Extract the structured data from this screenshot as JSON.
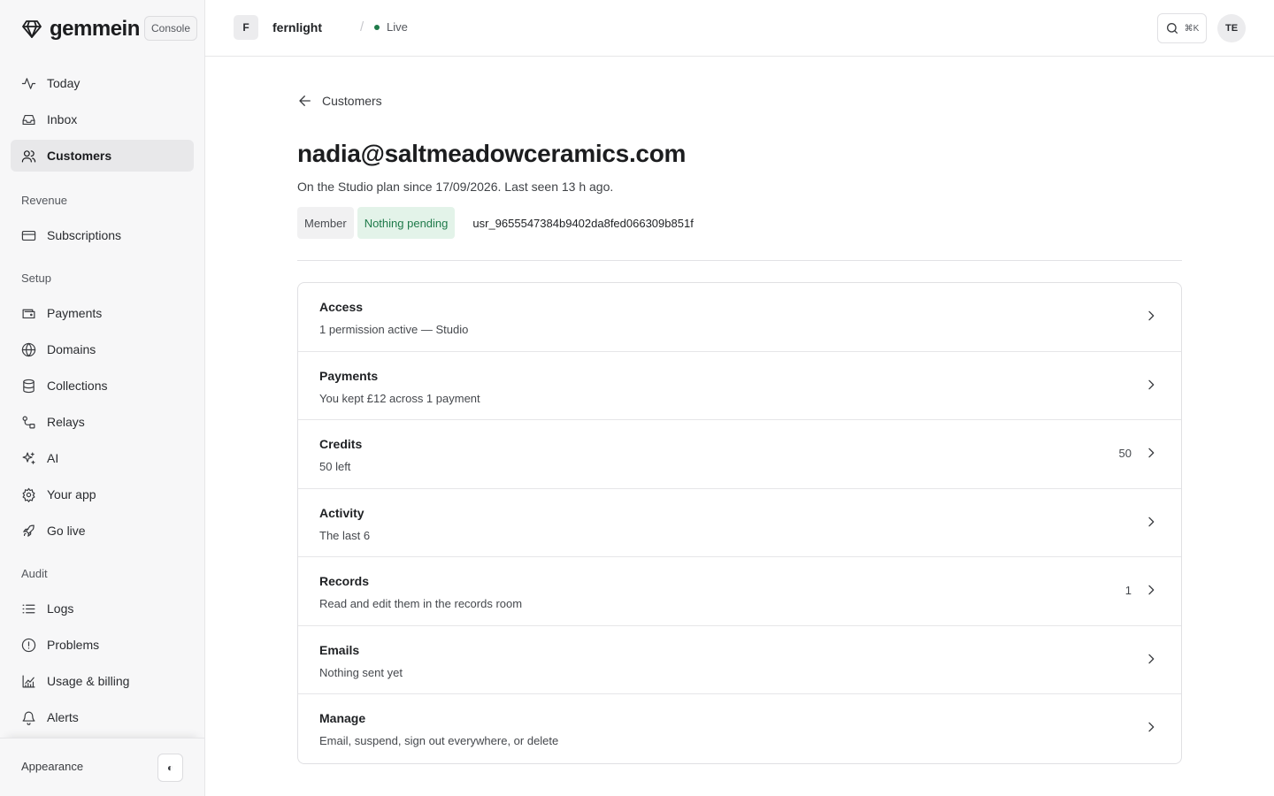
{
  "brand": {
    "name": "gemmein",
    "console_label": "Console"
  },
  "nav": {
    "main": [
      {
        "label": "Today",
        "icon": "activity-icon",
        "active": false
      },
      {
        "label": "Inbox",
        "icon": "inbox-icon",
        "active": false
      },
      {
        "label": "Customers",
        "icon": "users-icon",
        "active": true
      }
    ],
    "revenue_heading": "Revenue",
    "revenue": [
      {
        "label": "Subscriptions",
        "icon": "credit-card-icon"
      }
    ],
    "setup_heading": "Setup",
    "setup": [
      {
        "label": "Payments",
        "icon": "wallet-icon"
      },
      {
        "label": "Domains",
        "icon": "globe-icon"
      },
      {
        "label": "Collections",
        "icon": "database-icon"
      },
      {
        "label": "Relays",
        "icon": "relay-icon"
      },
      {
        "label": "AI",
        "icon": "sparkles-icon"
      },
      {
        "label": "Your app",
        "icon": "gear-icon"
      },
      {
        "label": "Go live",
        "icon": "rocket-icon"
      }
    ],
    "audit_heading": "Audit",
    "audit": [
      {
        "label": "Logs",
        "icon": "list-icon"
      },
      {
        "label": "Problems",
        "icon": "alert-circle-icon"
      },
      {
        "label": "Usage & billing",
        "icon": "chart-icon"
      },
      {
        "label": "Alerts",
        "icon": "bell-icon"
      }
    ]
  },
  "footer": {
    "appearance_label": "Appearance",
    "theme_glyph": "◐"
  },
  "topbar": {
    "project_initial": "F",
    "project_name": "fernlight",
    "separator": "/",
    "environment": "Live",
    "search_shortcut": "⌘K",
    "user_initials": "TE"
  },
  "customer": {
    "back_label": "Customers",
    "email": "nadia@saltmeadowceramics.com",
    "subtitle": "On the Studio plan since 17/09/2026. Last seen 13 h ago.",
    "role_badge": "Member",
    "status_badge": "Nothing pending",
    "user_id": "usr_9655547384b9402da8fed066309b851f"
  },
  "sections": [
    {
      "title": "Access",
      "subtitle": "1 permission active — Studio",
      "count": ""
    },
    {
      "title": "Payments",
      "subtitle": "You kept £12 across 1 payment",
      "count": ""
    },
    {
      "title": "Credits",
      "subtitle": "50 left",
      "count": "50"
    },
    {
      "title": "Activity",
      "subtitle": "The last 6",
      "count": ""
    },
    {
      "title": "Records",
      "subtitle": "Read and edit them in the records room",
      "count": "1"
    },
    {
      "title": "Emails",
      "subtitle": "Nothing sent yet",
      "count": ""
    },
    {
      "title": "Manage",
      "subtitle": "Email, suspend, sign out everywhere, or delete",
      "count": ""
    }
  ],
  "colors": {
    "accent_green": "#1f7a4a",
    "status_bg": "#e3f3e9",
    "sidebar_bg": "#f7f7f8"
  }
}
